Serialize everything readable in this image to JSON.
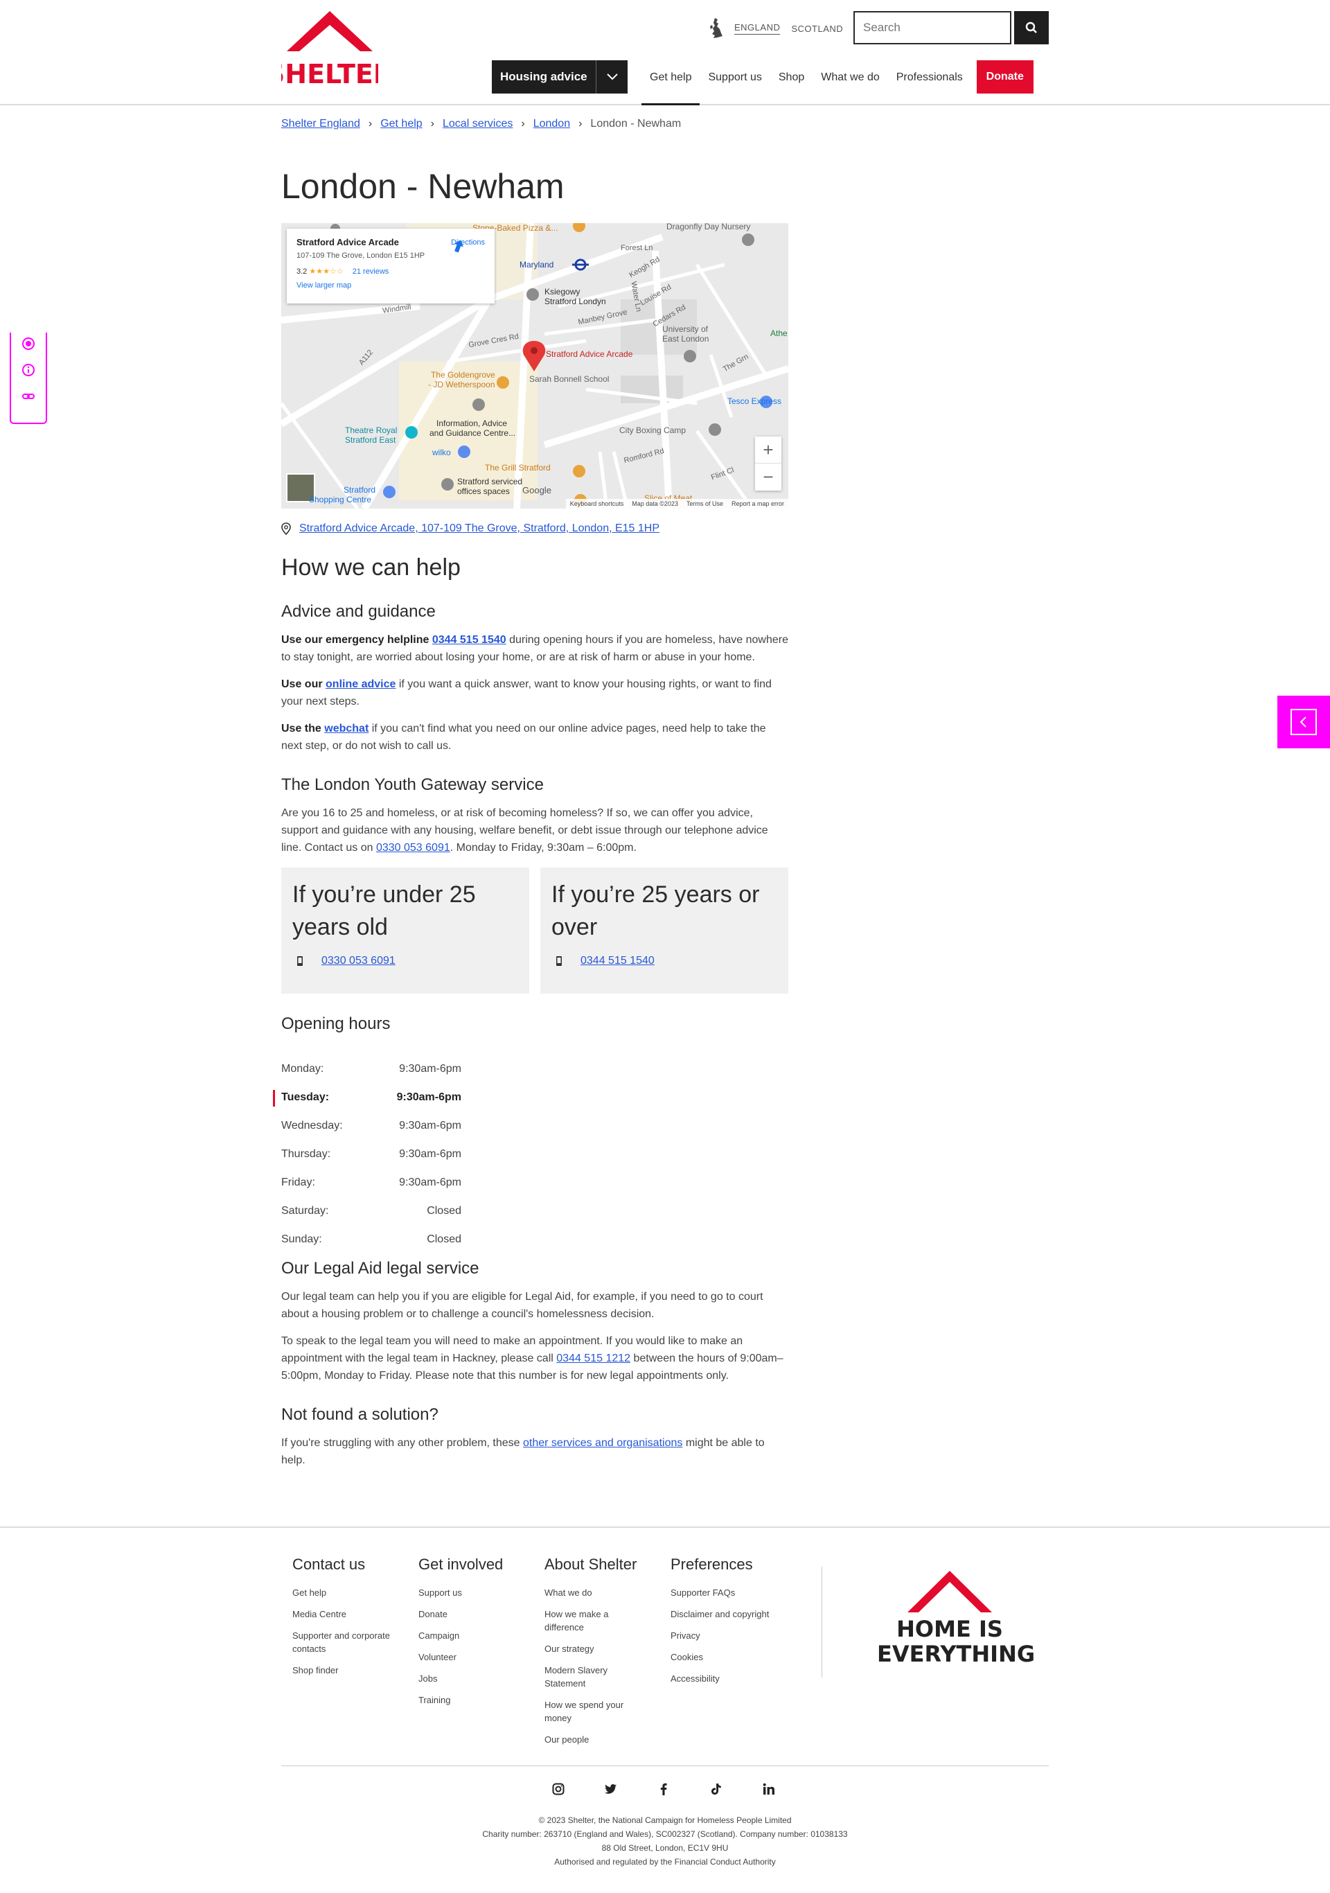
{
  "header": {
    "logo_text": "SHELTER",
    "regions": [
      "ENGLAND",
      "SCOTLAND"
    ],
    "search_placeholder": "Search",
    "housing_advice": "Housing advice",
    "nav": [
      "Get help",
      "Support us",
      "Shop",
      "What we do",
      "Professionals"
    ],
    "donate": "Donate"
  },
  "breadcrumb": [
    "Shelter England",
    "Get help",
    "Local services",
    "London",
    "London - Newham"
  ],
  "page_title": "London - Newham",
  "map": {
    "card_title": "Stratford Advice Arcade",
    "card_address": "107-109 The Grove, London E15 1HP",
    "rating": "3.2",
    "stars": "★★★☆☆",
    "reviews": "21 reviews",
    "view_larger": "View larger map",
    "directions": "Directions",
    "labels": {
      "stone_baked": "Stone-Baked Pizza &...",
      "dragonfly": "Dragonfly Day Nursery",
      "maryland": "Maryland",
      "forest_ln": "Forest Ln",
      "keogh": "Keogh Rd",
      "ksiegowy": "Ksiegowy",
      "ksiegowy2": "Stratford Londyn",
      "louise": "Louise Rd",
      "manbey": "Manbey Grove",
      "windmill": "Windmill",
      "water_ln": "Water Ln",
      "cedars": "Cedars Rd",
      "uel1": "University of",
      "uel2": "East London",
      "grove_cres": "Grove Cres Rd",
      "marker": "Stratford Advice Arcade",
      "a112": "A112",
      "goldengrove1": "The Goldengrove",
      "goldengrove2": "- JD Wetherspoon",
      "bonnell": "Sarah Bonnell School",
      "tesco": "Tesco Express",
      "the_grn": "The Grn",
      "theatre1": "Theatre Royal",
      "theatre2": "Stratford East",
      "info1": "Information, Advice",
      "info2": "and Guidance Centre...",
      "boxing": "City Boxing Camp",
      "wilko": "wilko",
      "grill": "The Grill Stratford",
      "romford": "Romford Rd",
      "flint": "Flint Cl",
      "stratford_sc1": "Stratford",
      "stratford_sc2": "Shopping Centre",
      "serviced1": "Stratford serviced",
      "serviced2": "offices spaces",
      "slice": "Slice of Meat",
      "atheist": "Athe",
      "google": "Google",
      "footer_keys": "Keyboard shortcuts",
      "footer_data": "Map data ©2023",
      "footer_terms": "Terms of Use",
      "footer_report": "Report a map error"
    }
  },
  "address": "Stratford Advice Arcade, 107-109 The Grove, Stratford, London, E15 1HP",
  "how_we_help": "How we can help",
  "advice": {
    "heading": "Advice and guidance",
    "p1_lead": "Use our emergency helpline",
    "p1_phone": "0344 515 1540",
    "p1_rest": " during opening hours if you are homeless, have nowhere to stay tonight, are worried about losing your home, or are at risk of harm or abuse in your home.",
    "p2_lead": "Use our",
    "p2_link": "online advice",
    "p2_rest": " if you want a quick answer, want to know your housing rights, or want to find your next steps.",
    "p3_lead": "Use the",
    "p3_link": "webchat",
    "p3_rest": " if you can't find what you need on our online advice pages, need help to take the next step, or do not wish to call us."
  },
  "youth": {
    "heading": "The London Youth Gateway service",
    "text": "Are you 16 to 25 and homeless, or at risk of becoming homeless? If so, we can offer you advice, support and guidance with any housing, welfare benefit, or debt issue through our telephone advice line. Contact us on ",
    "phone": "0330 053 6091",
    "text_end": ". Monday to Friday, 9:30am – 6:00pm."
  },
  "cards": [
    {
      "title": "If you’re under 25 years old",
      "phone": "0330 053 6091"
    },
    {
      "title": "If you’re 25 years or over",
      "phone": "0344 515 1540"
    }
  ],
  "hours": {
    "heading": "Opening hours",
    "rows": [
      {
        "day": "Monday:",
        "time": "9:30am-6pm"
      },
      {
        "day": "Tuesday:",
        "time": "9:30am-6pm"
      },
      {
        "day": "Wednesday:",
        "time": "9:30am-6pm"
      },
      {
        "day": "Thursday:",
        "time": "9:30am-6pm"
      },
      {
        "day": "Friday:",
        "time": "9:30am-6pm"
      },
      {
        "day": "Saturday:",
        "time": "Closed"
      },
      {
        "day": "Sunday:",
        "time": "Closed"
      }
    ]
  },
  "legal": {
    "heading": "Our Legal Aid legal service",
    "p1": "Our legal team can help you if you are eligible for Legal Aid, for example, if you need to go to court about a housing problem or to challenge a council's homelessness decision.",
    "p2_a": "To speak to the legal team you will need to make an appointment. If you would like to make an appointment with the legal team in Hackney, please call ",
    "p2_phone": "0344 515 1212",
    "p2_b": " between the hours of 9:00am–5:00pm, Monday to Friday. Please note that this number is for new legal appointments only."
  },
  "not_found": {
    "heading": "Not found a solution?",
    "text_a": "If you're struggling with any other problem, these ",
    "link": "other services and organisations",
    "text_b": " might be able to help."
  },
  "footer": {
    "columns": [
      {
        "heading": "Contact us",
        "links": [
          "Get help",
          "Media Centre",
          "Supporter and corporate contacts",
          "Shop finder"
        ]
      },
      {
        "heading": "Get involved",
        "links": [
          "Support us",
          "Donate",
          "Campaign",
          "Volunteer",
          "Jobs",
          "Training"
        ]
      },
      {
        "heading": "About Shelter",
        "links": [
          "What we do",
          "How we make a difference",
          "Our strategy",
          "Modern Slavery Statement",
          "How we spend your money",
          "Our people"
        ]
      },
      {
        "heading": "Preferences",
        "links": [
          "Supporter FAQs",
          "Disclaimer and copyright",
          "Privacy",
          "Cookies",
          "Accessibility"
        ]
      }
    ],
    "tagline_1": "HOME IS",
    "tagline_2": "EVERYTHING",
    "legal_lines": [
      "© 2023 Shelter, the National Campaign for Homeless People Limited",
      "Charity number: 263710 (England and Wales), SC002327 (Scotland). Company number: 01038133",
      "88 Old Street, London, EC1V 9HU",
      "Authorised and regulated by the Financial Conduct Authority"
    ]
  },
  "colors": {
    "brand_red": "#e20b2d",
    "dark": "#1e1e1e",
    "link": "#2757d6",
    "widget_magenta": "#ff00ff"
  }
}
